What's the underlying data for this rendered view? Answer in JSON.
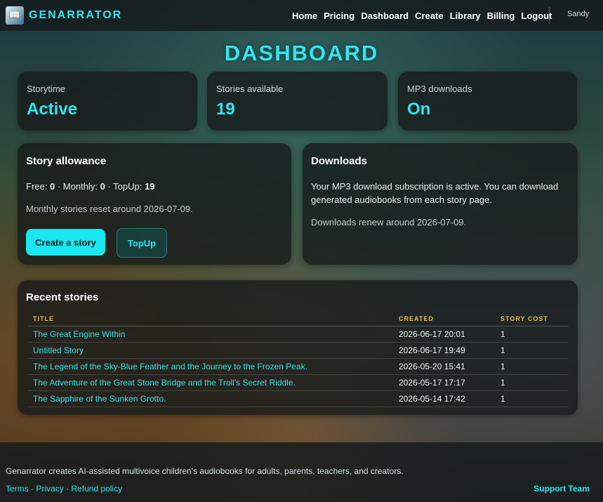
{
  "brand": {
    "name": "GENARRATOR",
    "logo_icon": "book-logo-icon"
  },
  "nav": {
    "items": [
      {
        "label": "Home"
      },
      {
        "label": "Pricing"
      },
      {
        "label": "Dashboard"
      },
      {
        "label": "Create"
      },
      {
        "label": "Library"
      },
      {
        "label": "Billing"
      },
      {
        "label": "Logout"
      }
    ],
    "user": "Sandy"
  },
  "page_title": "DASHBOARD",
  "stats": [
    {
      "label": "Storytime",
      "value": "Active"
    },
    {
      "label": "Stories available",
      "value": "19"
    },
    {
      "label": "MP3 downloads",
      "value": "On"
    }
  ],
  "allowance": {
    "heading": "Story allowance",
    "free_label": "Free:",
    "free_value": "0",
    "monthly_label": "Monthly:",
    "monthly_value": "0",
    "topup_label": "TopUp:",
    "topup_value": "19",
    "sep": "·",
    "reset_text": "Monthly stories reset around 2026-07-09.",
    "create_button": "Create a story",
    "topup_button": "TopUp"
  },
  "downloads": {
    "heading": "Downloads",
    "description": "Your MP3 download subscription is active. You can download generated audiobooks from each story page.",
    "renew_text": "Downloads renew around 2026-07-09."
  },
  "recent": {
    "heading": "Recent stories",
    "columns": [
      "TITLE",
      "CREATED",
      "STORY COST"
    ],
    "rows": [
      {
        "title": "The Great Engine Within",
        "created": "2026-06-17 20:01",
        "cost": "1"
      },
      {
        "title": "Untitled Story",
        "created": "2026-06-17 19:49",
        "cost": "1"
      },
      {
        "title": "The Legend of the Sky-Blue Feather and the Journey to the Frozen Peak.",
        "created": "2026-05-20 15:41",
        "cost": "1"
      },
      {
        "title": "The Adventure of the Great Stone Bridge and the Troll's Secret Riddle.",
        "created": "2026-05-17 17:17",
        "cost": "1"
      },
      {
        "title": "The Sapphire of the Sunken Grotto.",
        "created": "2026-05-14 17:42",
        "cost": "1"
      }
    ]
  },
  "footer": {
    "text": "Genarrator creates AI-assisted multivoice children's audiobooks for adults, parents, teachers, and creators.",
    "links": [
      {
        "label": "Terms"
      },
      {
        "label": "Privacy"
      },
      {
        "label": "Refund policy"
      }
    ],
    "sep": "·",
    "support": "Support Team"
  },
  "colors": {
    "accent": "#2ee6ef",
    "header_gold": "#e7c24a",
    "card_bg": "#161a1a"
  }
}
